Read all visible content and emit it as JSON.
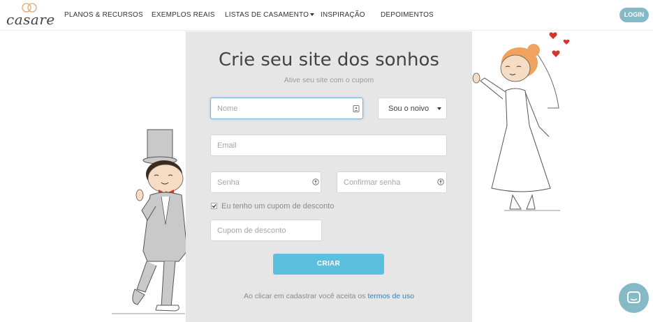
{
  "header": {
    "logo_text": "casare",
    "nav": [
      {
        "label": "PLANOS & RECURSOS"
      },
      {
        "label": "EXEMPLOS REAIS"
      },
      {
        "label": "LISTAS DE CASAMENTO"
      },
      {
        "label": "INSPIRAÇÃO"
      },
      {
        "label": "DEPOIMENTOS"
      }
    ],
    "login_label": "LOGIN"
  },
  "form": {
    "title": "Crie seu site dos sonhos",
    "subtitle": "Ative seu site com o cupom",
    "name_placeholder": "Nome",
    "role_select_value": "Sou o noivo",
    "email_placeholder": "Email",
    "password_placeholder": "Senha",
    "confirm_password_placeholder": "Confirmar senha",
    "coupon_checkbox_label": "Eu tenho um cupom de desconto",
    "coupon_checked": true,
    "coupon_placeholder": "Cupom de desconto",
    "submit_label": "CRIAR",
    "terms_prefix": "Ao clicar em cadastrar você aceita os",
    "terms_link": "termos de uso"
  },
  "colors": {
    "accent": "#5bc0de",
    "login": "#86b9c8",
    "panel": "#e6e6e6",
    "link": "#3a7fb0"
  }
}
